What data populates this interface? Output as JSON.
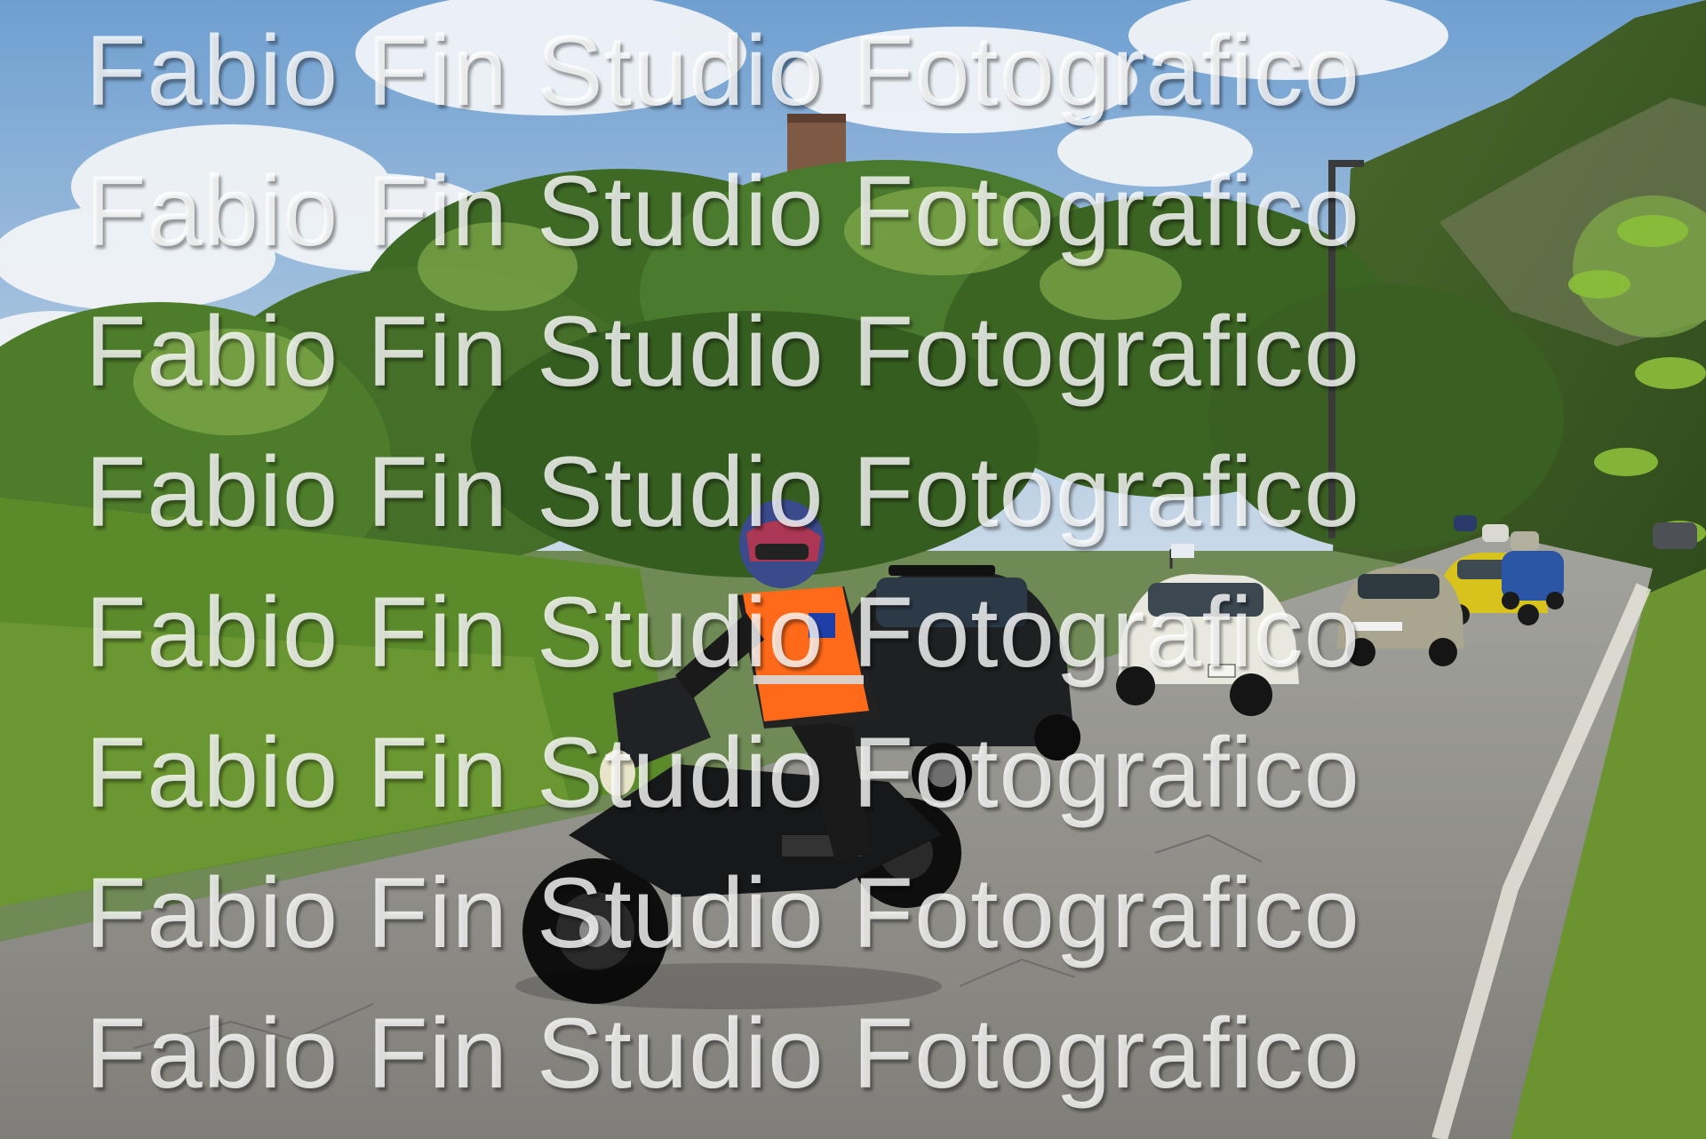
{
  "watermark": {
    "lines": [
      "Fabio Fin Studio Fotografico",
      "Fabio Fin Studio Fotografico",
      "Fabio Fin Studio Fotografico",
      "Fabio Fin Studio Fotografico",
      "Fabio Fin Studio Fotografico",
      "Fabio Fin Studio Fotografico",
      "Fabio Fin Studio Fotografico",
      "Fabio Fin Studio Fotografico"
    ]
  },
  "colors": {
    "sky": "#8fb3d6",
    "foliage": "#4f7a2c",
    "road": "#8d8b86",
    "vest": "#ff6a1a",
    "car_dark": "#1e2022",
    "car_white": "#e9e8df",
    "car_yellow": "#d8c21c"
  }
}
